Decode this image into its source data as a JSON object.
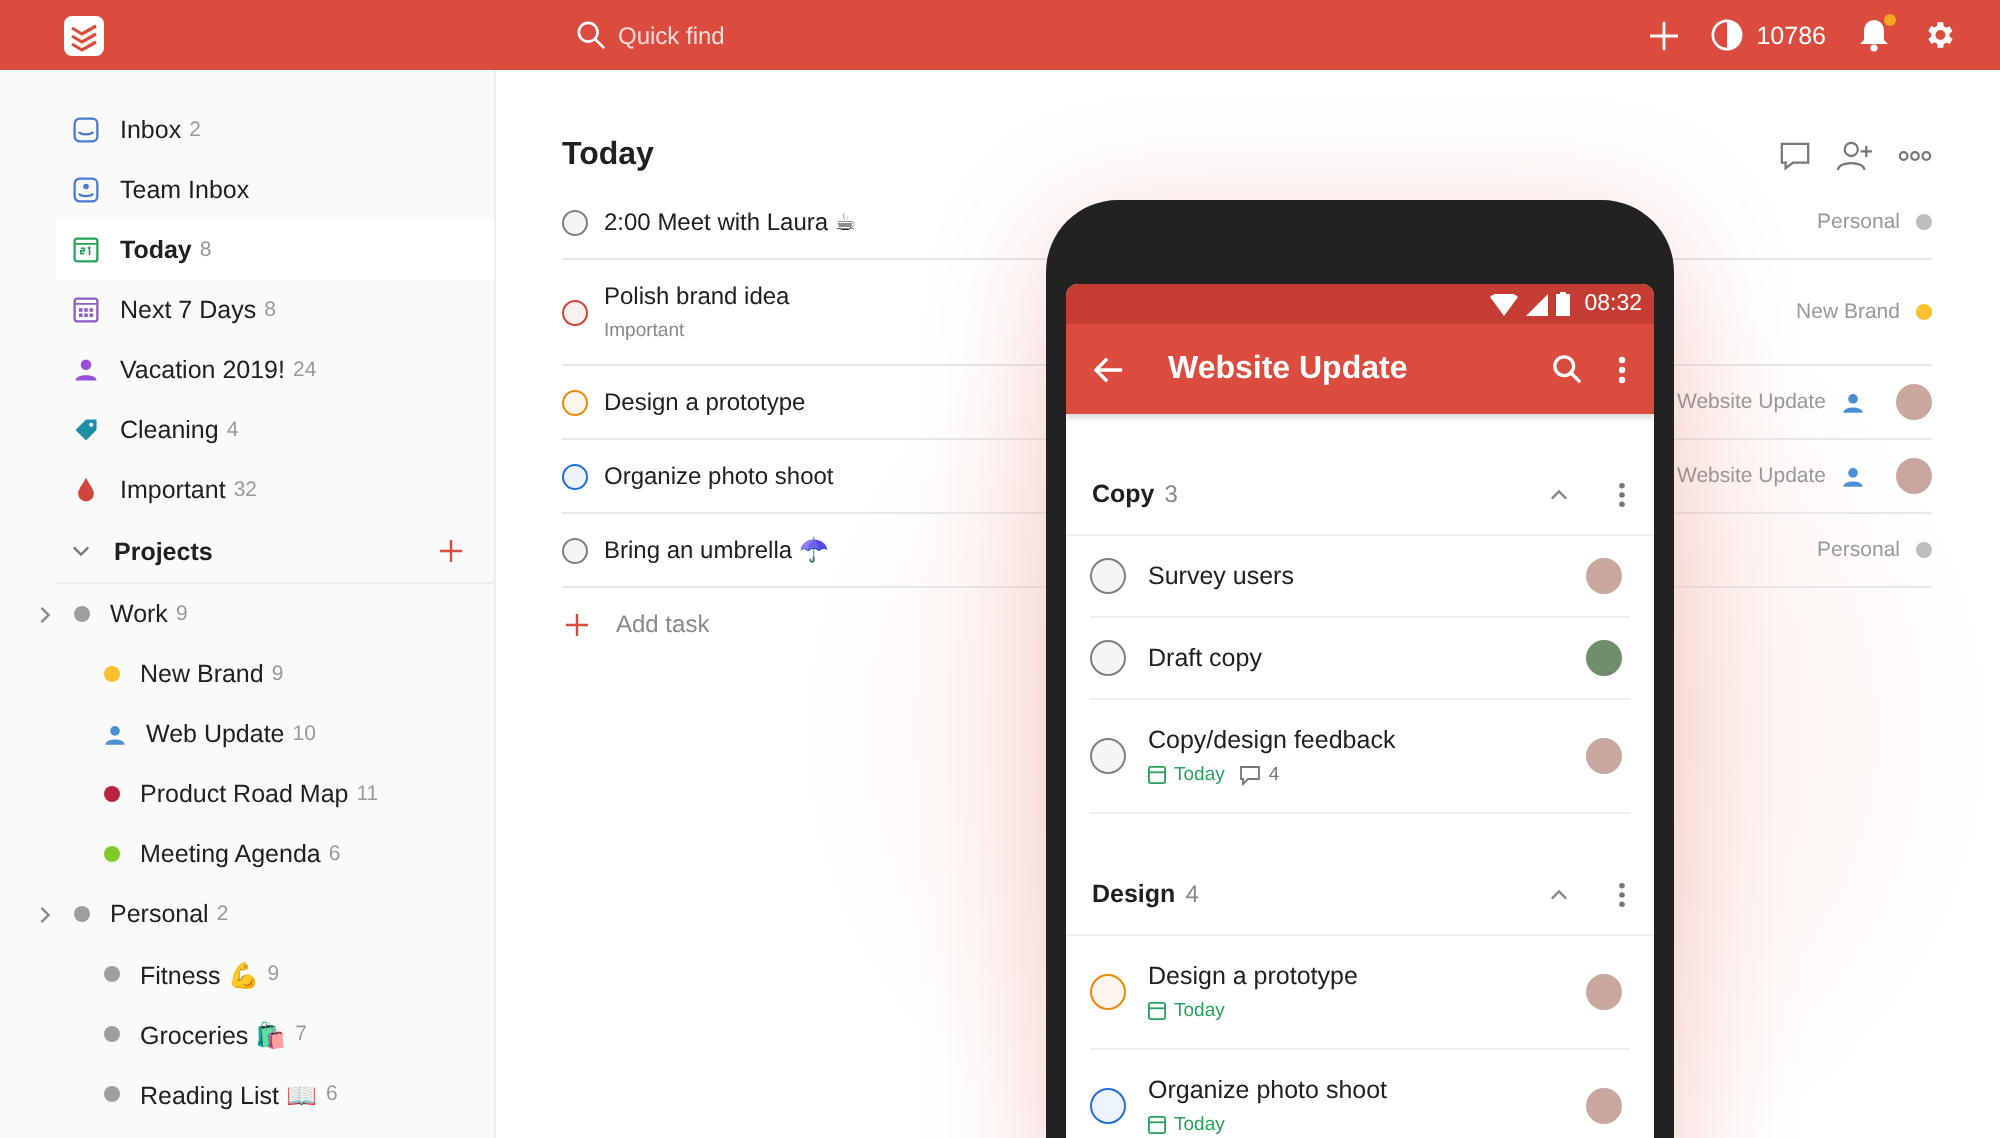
{
  "top_bar": {
    "search_placeholder": "Quick find",
    "karma": "10786",
    "unread_notifications": true
  },
  "sidebar": {
    "filters": [
      {
        "label": "Inbox",
        "count": "2",
        "kind": "inbox",
        "selected": false
      },
      {
        "label": "Team Inbox",
        "kind": "team",
        "selected": false
      },
      {
        "label": "Today",
        "count": "8",
        "kind": "today",
        "selected": true
      },
      {
        "label": "Next 7 Days",
        "count": "8",
        "kind": "week",
        "selected": false
      },
      {
        "label": "Vacation 2019!",
        "count": "24",
        "kind": "person",
        "selected": false
      },
      {
        "label": "Cleaning",
        "count": "4",
        "kind": "tag",
        "selected": false
      },
      {
        "label": "Important",
        "count": "32",
        "kind": "drop",
        "selected": false
      }
    ],
    "projects_header": {
      "label": "Projects",
      "expanded": true
    },
    "projects": [
      {
        "name": "Work",
        "count": "9",
        "kind": "dot",
        "color": "#9e9e9e",
        "children": [
          {
            "name": "New Brand",
            "count": "9",
            "kind": "dot",
            "color": "#fbc02d"
          },
          {
            "name": "Web Update",
            "count": "10",
            "kind": "person",
            "color": "#4a90d9"
          },
          {
            "name": "Product Road Map",
            "count": "11",
            "kind": "dot",
            "color": "#b8253e"
          },
          {
            "name": "Meeting Agenda",
            "count": "6",
            "kind": "dot",
            "color": "#7ecc2a"
          }
        ]
      },
      {
        "name": "Personal",
        "count": "2",
        "kind": "dot",
        "color": "#9e9e9e",
        "children": [
          {
            "name": "Fitness 💪",
            "count": "9",
            "kind": "dot",
            "color": "#9e9e9e"
          },
          {
            "name": "Groceries 🛍️",
            "count": "7",
            "kind": "dot",
            "color": "#9e9e9e"
          },
          {
            "name": "Reading List 📖",
            "count": "6",
            "kind": "dot",
            "color": "#9e9e9e"
          }
        ]
      }
    ]
  },
  "main": {
    "title": "Today",
    "tasks": [
      {
        "title": "2:00 Meet with Laura ☕",
        "color": "#808080",
        "project": {
          "label": "Personal",
          "kind": "dot",
          "color": "#bdbdbd"
        },
        "assigned": false
      },
      {
        "title": "Polish brand idea",
        "note": "Important",
        "color": "#d1453b",
        "project": {
          "label": "New Brand",
          "kind": "dot",
          "color": "#fbc02d"
        },
        "assigned": false
      },
      {
        "title": "Design a prototype",
        "color": "#eb8909",
        "project": {
          "label": "Website Update",
          "kind": "person",
          "color": "#4a90d9"
        },
        "assigned": true
      },
      {
        "title": "Organize photo shoot",
        "color": "#246fe0",
        "project": {
          "label": "Website Update",
          "kind": "person",
          "color": "#4a90d9"
        },
        "assigned": true
      },
      {
        "title": "Bring an umbrella ☂️",
        "color": "#808080",
        "project": {
          "label": "Personal",
          "kind": "dot",
          "color": "#bdbdbd"
        },
        "assigned": false
      }
    ],
    "add_task": "Add task"
  },
  "phone": {
    "time": "08:32",
    "title": "Website Update",
    "sections": [
      {
        "name": "Copy",
        "count": "3",
        "expanded": true,
        "tasks": [
          {
            "title": "Survey users",
            "color": "#808080"
          },
          {
            "title": "Draft copy",
            "color": "#808080"
          },
          {
            "title": "Copy/design feedback",
            "color": "#808080",
            "due": "Today",
            "comments": "4"
          }
        ]
      },
      {
        "name": "Design",
        "count": "4",
        "expanded": true,
        "tasks": [
          {
            "title": "Design a prototype",
            "color": "#eb8909",
            "due": "Today"
          },
          {
            "title": "Organize photo shoot",
            "color": "#246fe0",
            "due": "Today"
          }
        ]
      }
    ]
  }
}
